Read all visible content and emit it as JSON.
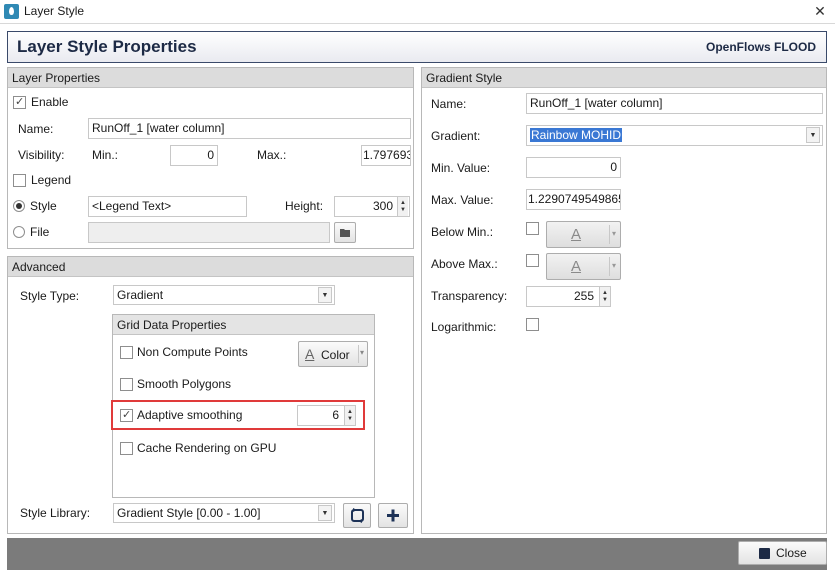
{
  "window": {
    "title": "Layer Style"
  },
  "header": {
    "title": "Layer Style Properties",
    "brand": "OpenFlows FLOOD"
  },
  "layer_properties": {
    "heading": "Layer Properties",
    "enable_label": "Enable",
    "name_label": "Name:",
    "name_value": "RunOff_1 [water column]",
    "visibility_label": "Visibility:",
    "min_label": "Min.:",
    "min_value": "0",
    "max_label": "Max.:",
    "max_value": "1.797693",
    "legend_label": "Legend",
    "style_label": "Style",
    "legend_text_value": "<Legend Text>",
    "height_label": "Height:",
    "height_value": "300",
    "file_label": "File",
    "file_value": ""
  },
  "advanced": {
    "heading": "Advanced",
    "style_type_label": "Style Type:",
    "style_type_value": "Gradient",
    "grid_data": {
      "heading": "Grid Data Properties",
      "non_compute_label": "Non Compute Points",
      "color_label": "Color",
      "smooth_polygons_label": "Smooth Polygons",
      "adaptive_label": "Adaptive smoothing",
      "adaptive_value": "6",
      "cache_label": "Cache Rendering on GPU"
    },
    "style_library_label": "Style Library:",
    "style_library_value": "Gradient Style [0.00 - 1.00]"
  },
  "gradient_style": {
    "heading": "Gradient Style",
    "name_label": "Name:",
    "name_value": "RunOff_1 [water column]",
    "gradient_label": "Gradient:",
    "gradient_value": "Rainbow MOHID",
    "min_label": "Min. Value:",
    "min_value": "0",
    "max_label": "Max. Value:",
    "max_value": "1.2290749549865",
    "below_label": "Below Min.:",
    "above_label": "Above Max.:",
    "transparency_label": "Transparency:",
    "transparency_value": "255",
    "log_label": "Logarithmic:"
  },
  "footer": {
    "close_label": "Close"
  },
  "colors": {
    "highlight": "#e03a3a",
    "header_border": "#3a4a6a",
    "footer": "#7b7b7b"
  }
}
